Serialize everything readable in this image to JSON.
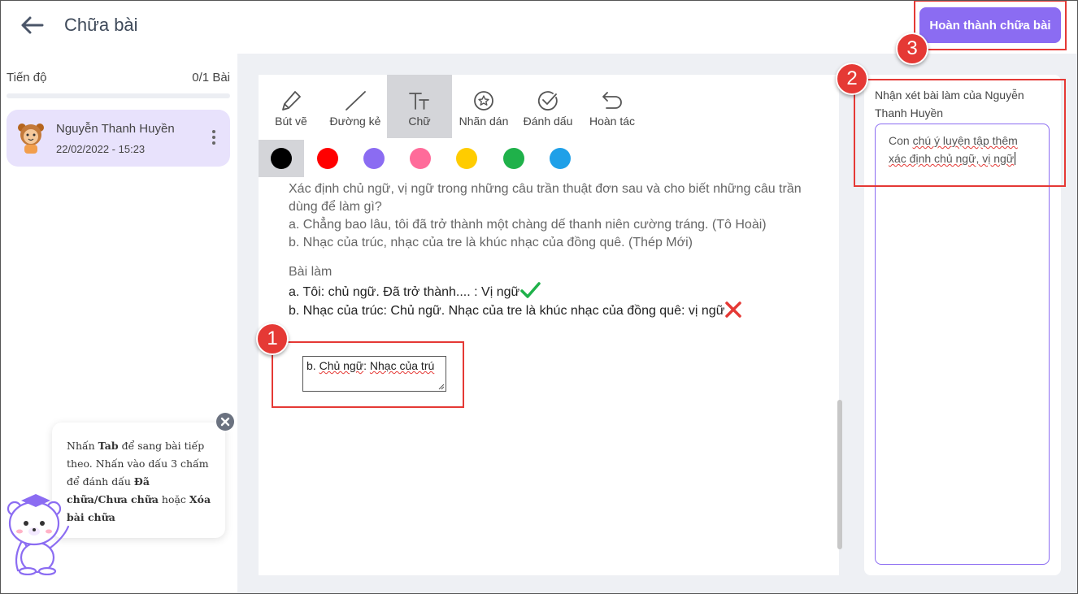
{
  "header": {
    "title": "Chữa bài",
    "finish_label": "Hoàn thành chữa bài"
  },
  "sidebar": {
    "progress_label": "Tiến độ",
    "progress_count": "0/1 Bài",
    "progress_fraction": 0,
    "student": {
      "name": "Nguyễn Thanh Huyền",
      "date": "22/02/2022 - 15:23"
    }
  },
  "tip": {
    "part1": "Nhấn ",
    "tab": "Tab",
    "part2": " để sang bài tiếp theo. Nhấn vào dấu 3 chấm để đánh dấu ",
    "marked": "Đã chữa/Chưa chữa",
    "part3": " hoặc ",
    "delete": "Xóa bài chữa"
  },
  "toolbar": {
    "tools": [
      {
        "label": "Bút vẽ",
        "icon": "pen-icon"
      },
      {
        "label": "Đường kẻ",
        "icon": "line-icon"
      },
      {
        "label": "Chữ",
        "icon": "text-icon",
        "active": true
      },
      {
        "label": "Nhãn dán",
        "icon": "sticker-icon"
      },
      {
        "label": "Đánh dấu",
        "icon": "check-circle-icon"
      },
      {
        "label": "Hoàn tác",
        "icon": "undo-icon"
      }
    ],
    "colors": [
      "#000000",
      "#ff0000",
      "#8b6cf2",
      "#ff6b9a",
      "#ffcc00",
      "#1fb14a",
      "#1fa0e8"
    ]
  },
  "content": {
    "q1": "Xác định chủ ngữ, vị ngữ trong những câu trần thuật đơn sau và cho biết những câu trần",
    "q2": "dùng để làm gì?",
    "qa": "a. Chẳng bao lâu, tôi đã trở thành một chàng dế thanh niên cường tráng. (Tô Hoài)",
    "qb": "b. Nhạc của trúc, nhạc của tre là khúc nhạc của đồng quê. (Thép Mới)",
    "work_title": "Bài làm",
    "ans_a": "a. Tôi: chủ ngữ. Đã trở thành.... : Vị ngữ",
    "ans_b": "b. Nhạc của trúc: Chủ ngữ. Nhạc của tre là khúc nhạc của đồng quê: vị ngữ"
  },
  "textbox": {
    "prefix": "b. ",
    "w1": "Chủ ngữ",
    "mid": ": ",
    "w2": "Nhạc của trú"
  },
  "comment": {
    "title": "Nhận xét bài làm của Nguyễn Thanh Huyền",
    "t1": "Con ",
    "w1": "chú ý luyện tập thêm",
    "br": " ",
    "w2": "xác định chủ ngữ, vị ngữ"
  },
  "badges": {
    "one": "1",
    "two": "2",
    "three": "3"
  },
  "colors": {
    "accent": "#8b6cf2",
    "highlight": "#e53935"
  }
}
